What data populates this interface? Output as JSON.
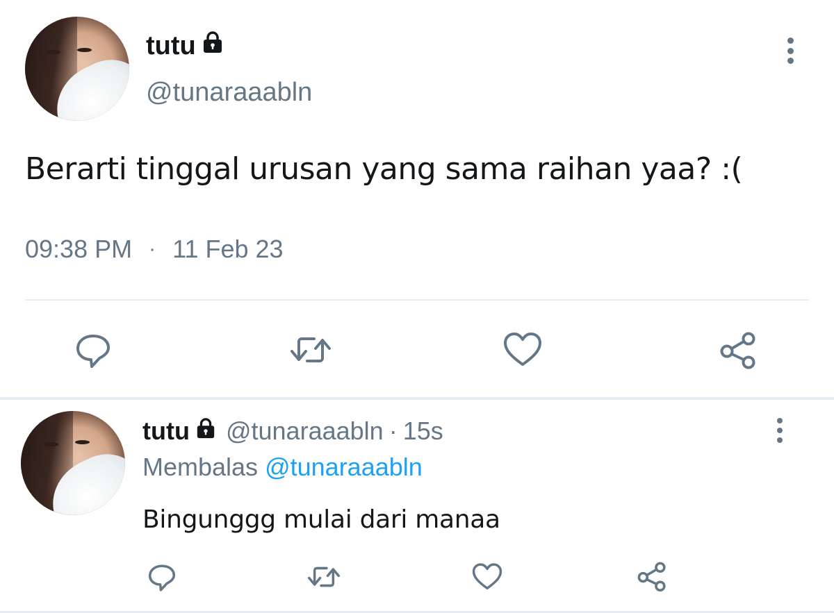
{
  "main_tweet": {
    "display_name": "tutu",
    "handle": "@tunaraaabln",
    "text": "Berarti tinggal urusan yang sama raihan yaa? :(",
    "time": "09:38 PM",
    "separator": "·",
    "date": "11 Feb 23",
    "icons": [
      "lock-icon",
      "more-icon",
      "reply-icon",
      "retweet-icon",
      "like-icon",
      "share-icon"
    ]
  },
  "reply_tweet": {
    "display_name": "tutu",
    "handle": "@tunaraaabln",
    "separator": "·",
    "time_ago": "15s",
    "replying_label": "Membalas",
    "replying_to": "@tunaraaabln",
    "text": "Bingunggg mulai dari manaa",
    "icons": [
      "lock-icon",
      "more-icon",
      "reply-icon",
      "retweet-icon",
      "like-icon",
      "share-icon"
    ]
  },
  "colors": {
    "text_primary": "#14171a",
    "text_secondary": "#657786",
    "link": "#1da1f2",
    "divider": "#e6ecf0"
  }
}
